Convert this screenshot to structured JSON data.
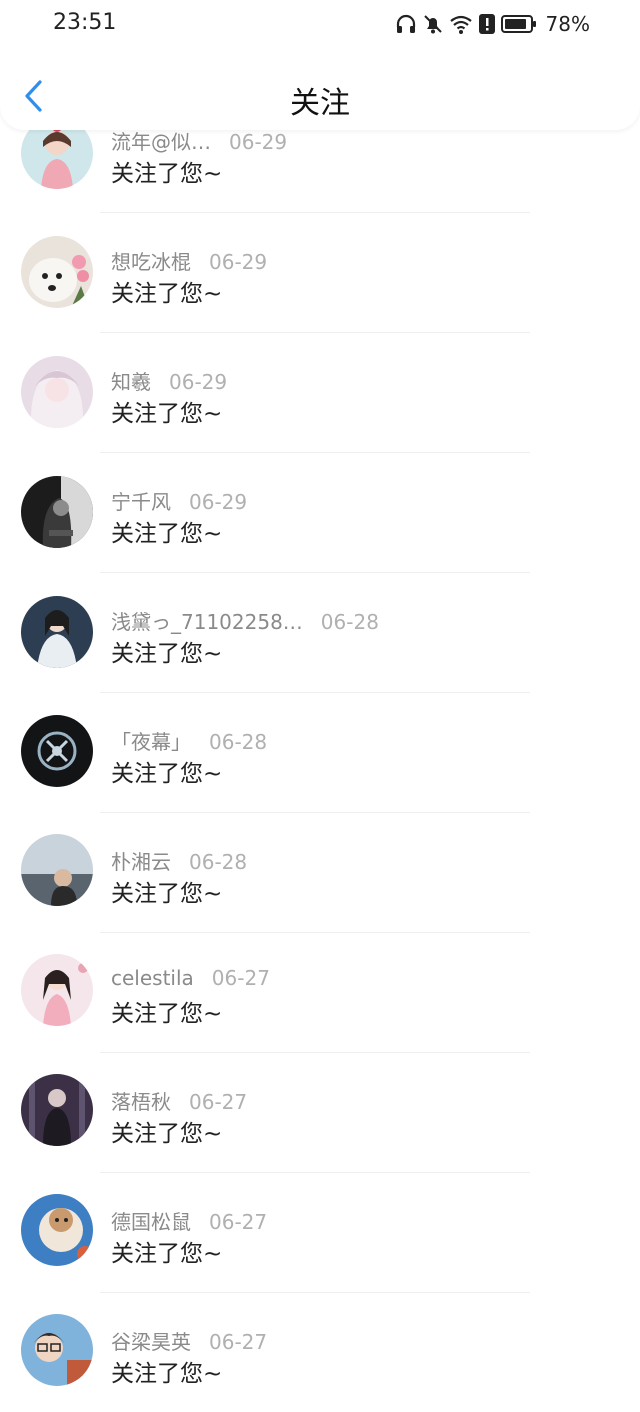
{
  "status_bar": {
    "time": "23:51",
    "battery": "78%",
    "icons": [
      "headphones-icon",
      "bell-muted-icon",
      "wifi-icon",
      "alert-icon",
      "battery-icon"
    ]
  },
  "nav": {
    "back_icon": "chevron-left-icon",
    "title": "关注"
  },
  "accent_color": "#2f8fea",
  "items": [
    {
      "name": "流年@似…",
      "date": "06-29",
      "message": "关注了您~",
      "avatar": "avatar-1"
    },
    {
      "name": "想吃冰棍",
      "date": "06-29",
      "message": "关注了您~",
      "avatar": "avatar-2"
    },
    {
      "name": "知羲",
      "date": "06-29",
      "message": "关注了您~",
      "avatar": "avatar-3"
    },
    {
      "name": "宁千风",
      "date": "06-29",
      "message": "关注了您~",
      "avatar": "avatar-4"
    },
    {
      "name": "浅黛っ_71102258…",
      "date": "06-28",
      "message": "关注了您~",
      "avatar": "avatar-5"
    },
    {
      "name": "「夜幕」",
      "date": "06-28",
      "message": "关注了您~",
      "avatar": "avatar-6"
    },
    {
      "name": "朴湘云",
      "date": "06-28",
      "message": "关注了您~",
      "avatar": "avatar-7"
    },
    {
      "name": "celestila",
      "date": "06-27",
      "message": "关注了您~",
      "avatar": "avatar-8"
    },
    {
      "name": "落梧秋",
      "date": "06-27",
      "message": "关注了您~",
      "avatar": "avatar-9"
    },
    {
      "name": "德国松鼠",
      "date": "06-27",
      "message": "关注了您~",
      "avatar": "avatar-10"
    },
    {
      "name": "谷梁昊英",
      "date": "06-27",
      "message": "关注了您~",
      "avatar": "avatar-11"
    }
  ]
}
